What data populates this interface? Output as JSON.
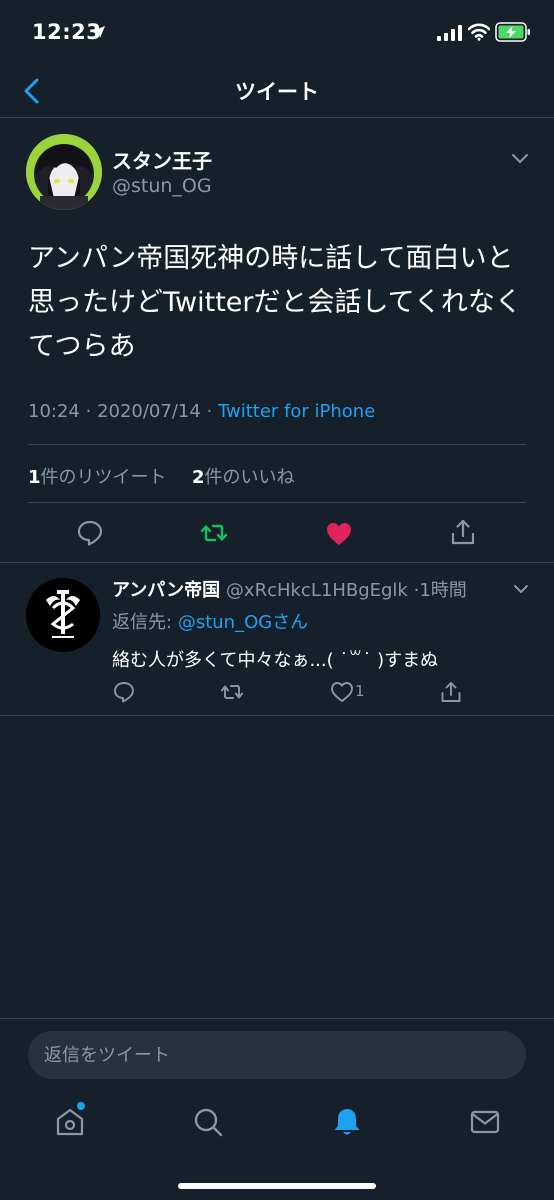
{
  "status_bar": {
    "time": "12:23"
  },
  "nav": {
    "title": "ツイート"
  },
  "tweet": {
    "author_name": "スタン王子",
    "author_handle": "@stun_OG",
    "text": "アンパン帝国死神の時に話して面白いと思ったけどTwitterだと会話してくれなくてつらあ",
    "time": "10:24",
    "date": "2020/07/14",
    "source": "Twitter for iPhone",
    "retweet_count": "1",
    "retweet_label": "件のリツイート",
    "like_count": "2",
    "like_label": "件のいいね"
  },
  "reply": {
    "author_name": "アンパン帝国",
    "author_handle": "@xRcHkcL1HBgEglk",
    "time_ago": "1時間",
    "replying_to_label": "返信先:",
    "replying_to_mention": "@stun_OGさん",
    "text": "絡む人が多くて中々なぁ...( ˙꒳˙ )すまぬ",
    "like_count": "1"
  },
  "compose": {
    "placeholder": "返信をツイート"
  },
  "tabbar": {
    "items": [
      "home-icon",
      "search-icon",
      "notifications-icon",
      "messages-icon"
    ]
  },
  "colors": {
    "background": "#15202b",
    "accent": "#1da1f2",
    "retweet_green": "#17bf63",
    "like_red": "#e0245e",
    "secondary_text": "#8899a6",
    "divider": "#38444d"
  }
}
